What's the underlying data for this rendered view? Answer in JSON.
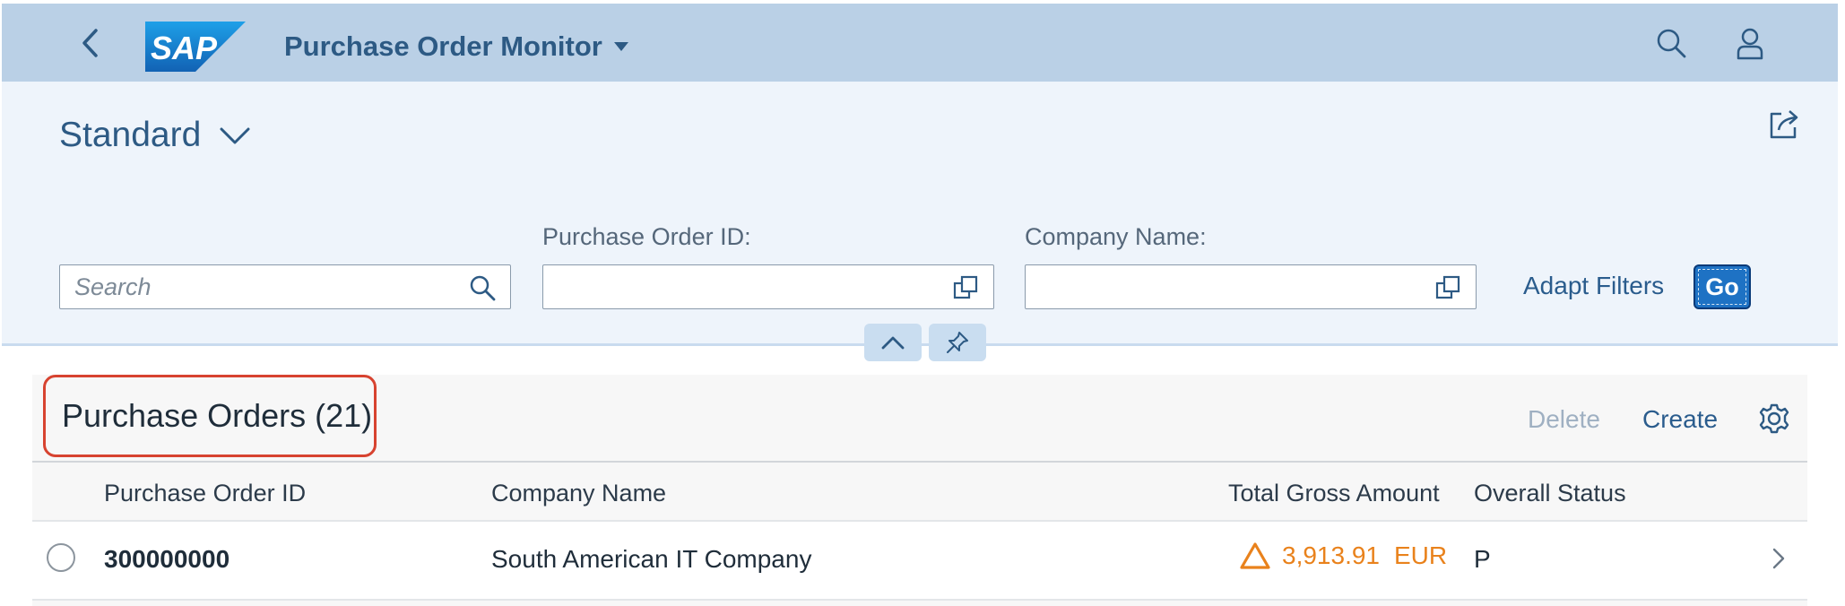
{
  "shell": {
    "app_title": "Purchase Order Monitor",
    "logo_text": "SAP",
    "brand_color": "#1f78c8"
  },
  "filterbar": {
    "variant_name": "Standard",
    "search": {
      "placeholder": "Search",
      "value": ""
    },
    "fields": [
      {
        "label": "Purchase Order ID:",
        "value": ""
      },
      {
        "label": "Company Name:",
        "value": ""
      }
    ],
    "adapt_filters_label": "Adapt Filters",
    "go_label": "Go"
  },
  "table": {
    "title": "Purchase Orders (21)",
    "toolbar": {
      "delete_label": "Delete",
      "create_label": "Create"
    },
    "columns": [
      "Purchase Order ID",
      "Company Name",
      "Total Gross Amount",
      "Overall Status"
    ],
    "rows": [
      {
        "po_id": "300000000",
        "company": "South American IT Company",
        "amount": "3,913.91",
        "currency": "EUR",
        "status": "P",
        "amount_state_icon": "warning-triangle-icon",
        "amount_color": "#e9821c"
      }
    ]
  }
}
